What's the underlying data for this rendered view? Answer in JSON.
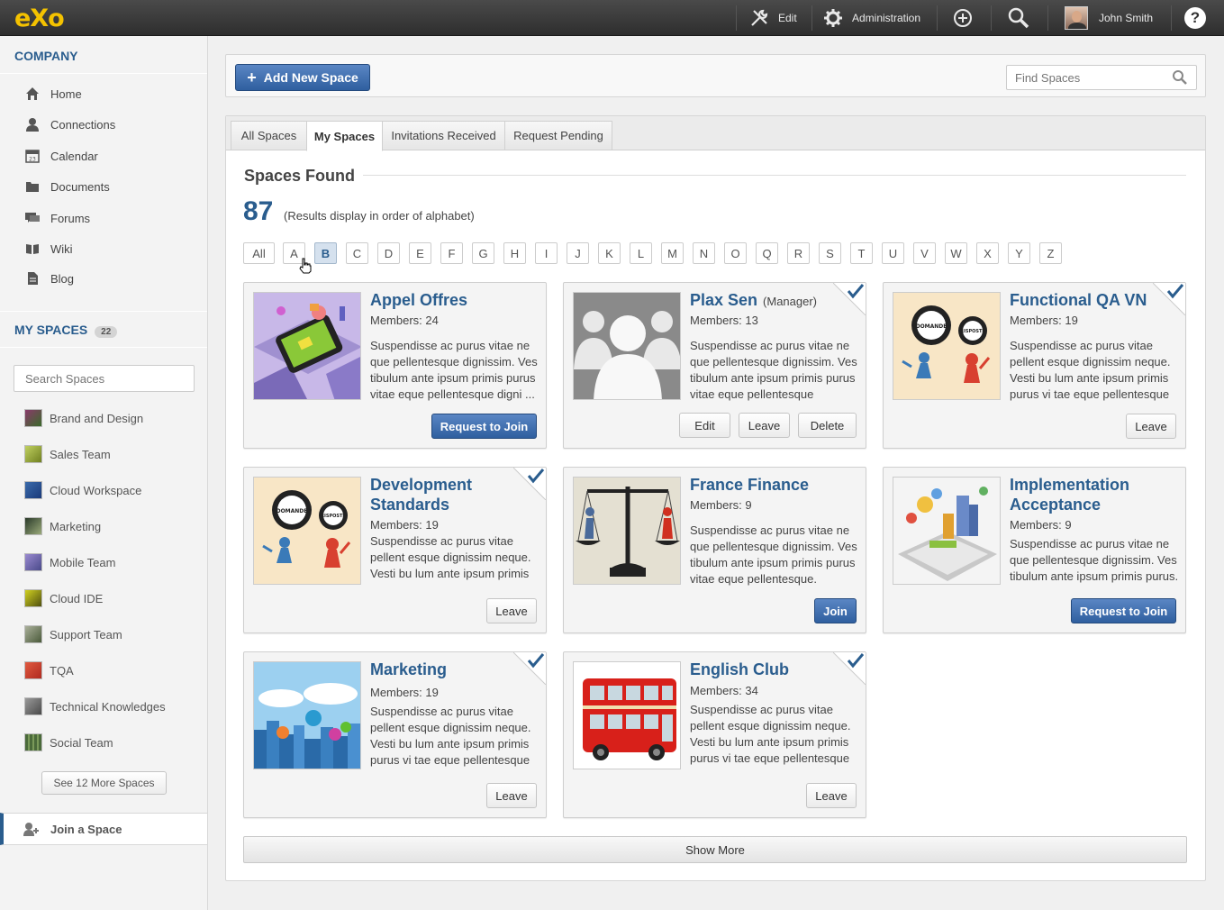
{
  "app": {
    "logo": "eXo"
  },
  "topbar": {
    "edit_label": "Edit",
    "admin_label": "Administration",
    "user_name": "John Smith",
    "help_label": "?"
  },
  "sidebar": {
    "company_heading": "COMPANY",
    "nav": [
      {
        "label": "Home",
        "icon": "home-icon"
      },
      {
        "label": "Connections",
        "icon": "person-icon"
      },
      {
        "label": "Calendar",
        "icon": "calendar-icon"
      },
      {
        "label": "Documents",
        "icon": "folder-icon"
      },
      {
        "label": "Forums",
        "icon": "chat-icon"
      },
      {
        "label": "Wiki",
        "icon": "book-icon"
      },
      {
        "label": "Blog",
        "icon": "document-icon"
      }
    ],
    "my_spaces_heading": "MY SPACES",
    "my_spaces_count": "22",
    "search_placeholder": "Search Spaces",
    "spaces": [
      {
        "label": "Brand and Design",
        "color": "#8a3a6a"
      },
      {
        "label": "Sales Team",
        "color": "#9ab040"
      },
      {
        "label": "Cloud Workspace",
        "color": "#2a5a9a"
      },
      {
        "label": "Marketing",
        "color": "#4a5a3a"
      },
      {
        "label": "Mobile Team",
        "color": "#7a6ab0"
      },
      {
        "label": "Cloud IDE",
        "color": "#b0b020"
      },
      {
        "label": "Support Team",
        "color": "#7a8a6a"
      },
      {
        "label": "TQA",
        "color": "#d04030"
      },
      {
        "label": "Technical Knowledges",
        "color": "#6a6a6a"
      },
      {
        "label": "Social Team",
        "color": "#4a6a3a"
      }
    ],
    "more_spaces_label": "See 12 More Spaces",
    "join_space_label": "Join a Space"
  },
  "toolbar": {
    "add_space_label": "Add New Space",
    "find_placeholder": "Find Spaces"
  },
  "tabs": [
    {
      "label": "All Spaces",
      "active": false
    },
    {
      "label": "My Spaces",
      "active": true
    },
    {
      "label": "Invitations Received",
      "active": false
    },
    {
      "label": "Request Pending",
      "active": false
    }
  ],
  "results": {
    "heading": "Spaces Found",
    "count": "87",
    "note": "(Results display in order of alphabet)"
  },
  "letters": [
    "All",
    "A",
    "B",
    "C",
    "D",
    "E",
    "F",
    "G",
    "H",
    "I",
    "J",
    "K",
    "L",
    "M",
    "N",
    "O",
    "Q",
    "R",
    "S",
    "T",
    "U",
    "V",
    "W",
    "X",
    "Y",
    "Z"
  ],
  "active_letter": "B",
  "cards": [
    {
      "title": "Appel Offres",
      "role": "",
      "members": "Members: 24",
      "desc": "Suspendisse ac purus vitae ne que pellentesque dignissim. Ves tibulum ante ipsum primis purus vitae eque pellentesque digni ...",
      "checked": false,
      "buttons": [
        {
          "label": "Request to Join",
          "primary": true
        }
      ]
    },
    {
      "title": "Plax Sen",
      "role": "(Manager)",
      "members": "Members: 13",
      "desc": "Suspendisse ac purus vitae ne que pellentesque dignissim. Ves tibulum ante ipsum primis purus vitae eque pellentesque",
      "checked": true,
      "buttons": [
        {
          "label": "Edit",
          "primary": false
        },
        {
          "label": "Leave",
          "primary": false
        },
        {
          "label": "Delete",
          "primary": false
        }
      ]
    },
    {
      "title": "Functional QA VN",
      "role": "",
      "members": "Members: 19",
      "desc": "Suspendisse ac purus vitae pellent esque dignissim neque. Vesti bu lum ante ipsum primis purus vi tae eque pellentesque",
      "checked": true,
      "buttons": [
        {
          "label": "Leave",
          "primary": false
        }
      ]
    },
    {
      "title": "Development Standards",
      "role": "",
      "members": "Members: 19",
      "desc": "Suspendisse ac purus vitae pellent esque dignissim neque. Vesti bu lum ante ipsum primis",
      "checked": true,
      "buttons": [
        {
          "label": "Leave",
          "primary": false
        }
      ]
    },
    {
      "title": "France Finance",
      "role": "",
      "members": "Members: 9",
      "desc": "Suspendisse ac purus vitae ne que pellentesque dignissim. Ves tibulum ante ipsum primis purus vitae eque pellentesque.",
      "checked": false,
      "buttons": [
        {
          "label": "Join",
          "primary": true
        }
      ]
    },
    {
      "title": "Implementation Acceptance",
      "role": "",
      "members": "Members: 9",
      "desc": "Suspendisse ac purus vitae ne que pellentesque dignissim. Ves tibulum ante ipsum primis purus.",
      "checked": false,
      "buttons": [
        {
          "label": "Request to Join",
          "primary": true
        }
      ]
    },
    {
      "title": "Marketing",
      "role": "",
      "members": "Members: 19",
      "desc": "Suspendisse ac purus vitae pellent esque dignissim neque. Vesti bu lum ante ipsum primis purus vi tae eque pellentesque",
      "checked": true,
      "buttons": [
        {
          "label": "Leave",
          "primary": false
        }
      ]
    },
    {
      "title": "English Club",
      "role": "",
      "members": "Members: 34",
      "desc": "Suspendisse ac purus vitae pellent esque dignissim neque. Vesti bu lum ante ipsum primis purus vi tae eque pellentesque",
      "checked": true,
      "buttons": [
        {
          "label": "Leave",
          "primary": false
        }
      ]
    }
  ],
  "show_more_label": "Show More"
}
